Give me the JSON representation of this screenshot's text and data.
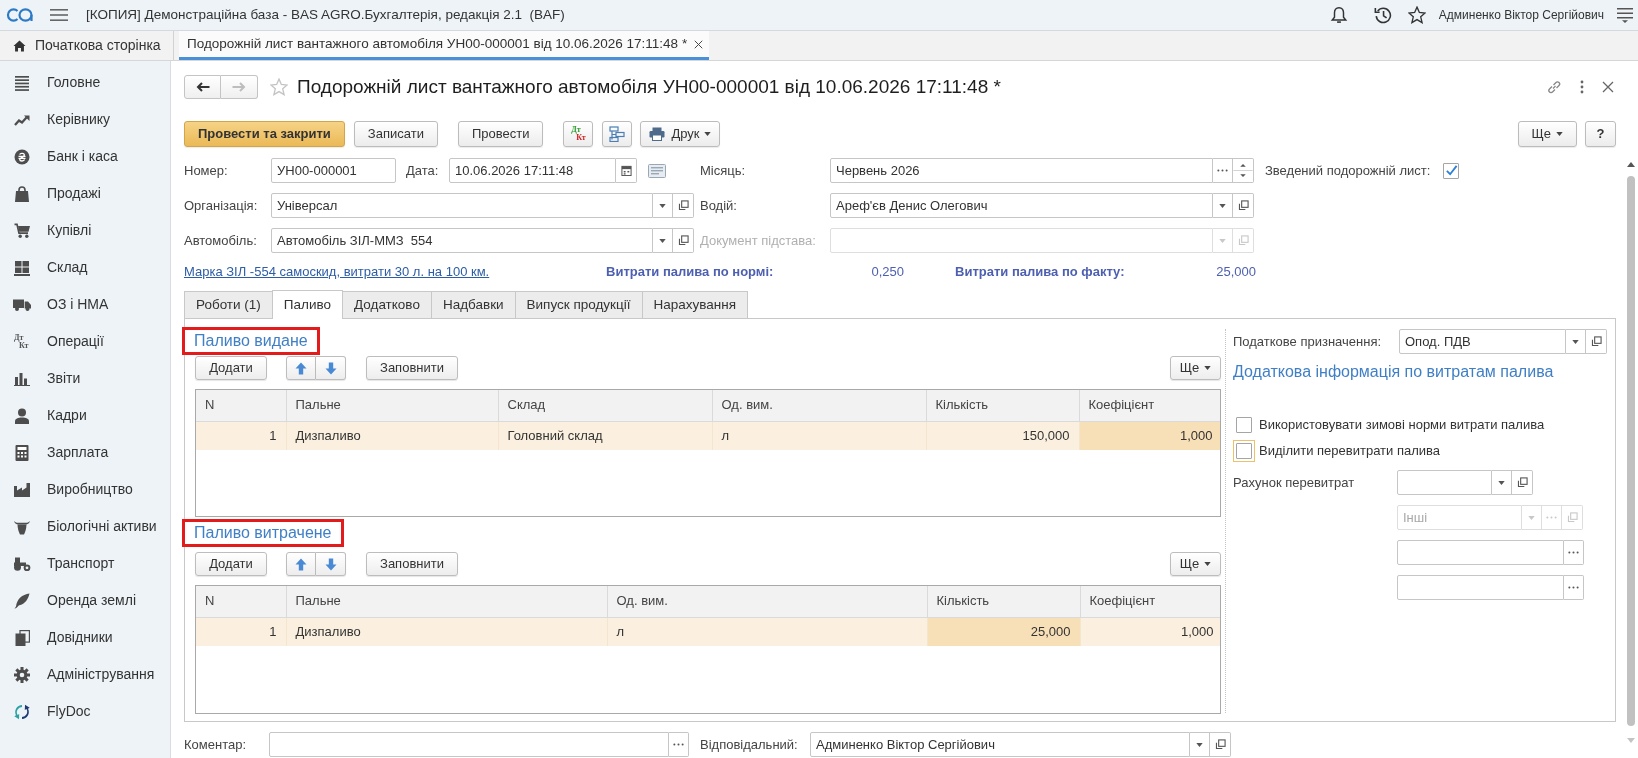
{
  "window": {
    "title": "[КОПИЯ] Демонстраційна база - BAS AGRO.Бухгалтерія, редакція 2.1  (BAF)",
    "user": "Админенко Віктор Сергійович"
  },
  "tab_strip": {
    "home": "Початкова сторінка",
    "tabs": [
      {
        "label": "Подорожній лист вантажного автомобіля УН00-000001 від 10.06.2026 17:11:48 *",
        "selected": true
      }
    ]
  },
  "sidebar": {
    "items": [
      {
        "label": "Головне"
      },
      {
        "label": "Керівнику"
      },
      {
        "label": "Банк і каса"
      },
      {
        "label": "Продажі"
      },
      {
        "label": "Купівлі"
      },
      {
        "label": "Склад"
      },
      {
        "label": "ОЗ і НМА"
      },
      {
        "label": "Операції",
        "icon_lines": [
          "Дт",
          "Кт"
        ]
      },
      {
        "label": "Звіти"
      },
      {
        "label": "Кадри"
      },
      {
        "label": "Зарплата"
      },
      {
        "label": "Виробництво"
      },
      {
        "label": "Біологічні активи"
      },
      {
        "label": "Транспорт"
      },
      {
        "label": "Оренда землі"
      },
      {
        "label": "Довідники"
      },
      {
        "label": "Адміністрування"
      },
      {
        "label": "FlyDoc"
      }
    ]
  },
  "document": {
    "title": "Подорожній лист вантажного автомобіля УН00-000001 від 10.06.2026 17:11:48 *"
  },
  "toolbar": {
    "buttons": [
      {
        "kind": "primary",
        "label": "Провести та закрити"
      },
      {
        "kind": "default",
        "label": "Записати"
      },
      {
        "kind": "default",
        "label": "Провести"
      },
      {
        "kind": "accounting",
        "lines": [
          "Дт",
          "Кт"
        ]
      },
      {
        "kind": "structure"
      },
      {
        "kind": "print",
        "label": "Друк"
      }
    ],
    "more": "Ще",
    "help": "?"
  },
  "form": {
    "number": {
      "label": "Номер:",
      "value": "УН00-000001"
    },
    "date": {
      "label": "Дата:",
      "value": "10.06.2026 17:11:48"
    },
    "month": {
      "label": "Місяць:",
      "value": "Червень 2026"
    },
    "summary_sheet": {
      "label": "Зведений подорожній лист:",
      "checked": true
    },
    "organization": {
      "label": "Організація:",
      "value": "Універсал"
    },
    "driver": {
      "label": "Водій:",
      "value": "Ареф'єв Денис Олегович"
    },
    "vehicle": {
      "label": "Автомобіль:",
      "value": "Автомобіль ЗІЛ-ММЗ  554"
    },
    "base_document": {
      "label": "Документ підстава:",
      "disabled": true
    }
  },
  "fuel_summary": {
    "link": "Марка ЗІЛ -554 самоскид, витрати 30 л. на 100 км.",
    "norm_label": "Витрати палива по нормі:",
    "norm_value": "0,250",
    "fact_label": "Витрати палива по факту:",
    "fact_value": "25,000"
  },
  "tabs": [
    {
      "label": "Роботи (1)",
      "selected": false
    },
    {
      "label": "Паливо",
      "selected": true
    },
    {
      "label": "Додатково",
      "selected": false
    },
    {
      "label": "Надбавки",
      "selected": false
    },
    {
      "label": "Випуск продукції",
      "selected": false
    },
    {
      "label": "Нарахування",
      "selected": false
    }
  ],
  "fuel_issued": {
    "title": "Паливо видане",
    "highlighted": true,
    "add": "Додати",
    "fill": "Заповнити",
    "more": "Ще",
    "columns": [
      {
        "label": "N",
        "kind": "number"
      },
      {
        "label": "Пальне",
        "kind": "text"
      },
      {
        "label": "Склад",
        "kind": "text"
      },
      {
        "label": "Од. вим.",
        "kind": "text"
      },
      {
        "label": "Кількість",
        "kind": "number"
      },
      {
        "label": "Коефіцієнт",
        "kind": "number"
      }
    ],
    "rows": [
      {
        "selected": true,
        "cells": [
          {
            "text": "1",
            "current": false
          },
          {
            "text": "Дизпаливо",
            "current": false
          },
          {
            "text": "Головний склад",
            "current": false
          },
          {
            "text": "л",
            "current": false
          },
          {
            "text": "150,000",
            "current": false
          },
          {
            "text": "1,000",
            "current": true
          }
        ]
      }
    ]
  },
  "fuel_used": {
    "title": "Паливо витрачене",
    "highlighted": true,
    "add": "Додати",
    "fill": "Заповнити",
    "more": "Ще",
    "columns": [
      {
        "label": "N",
        "kind": "number"
      },
      {
        "label": "Пальне",
        "kind": "text"
      },
      {
        "label": "Од. вим.",
        "kind": "text"
      },
      {
        "label": "Кількість",
        "kind": "number"
      },
      {
        "label": "Коефіцієнт",
        "kind": "number"
      }
    ],
    "rows": [
      {
        "selected": true,
        "cells": [
          {
            "text": "1",
            "current": false
          },
          {
            "text": "Дизпаливо",
            "current": false
          },
          {
            "text": "л",
            "current": false
          },
          {
            "text": "25,000",
            "current": true
          },
          {
            "text": "1,000",
            "current": false
          }
        ]
      }
    ]
  },
  "extra": {
    "tax_purpose": {
      "label": "Податкове призначення:",
      "value": "Опод. ПДВ"
    },
    "title": "Додаткова інформація по витратам палива",
    "options": [
      {
        "label": "Використовувати зимові норми витрати палива",
        "checked": false,
        "focused": false
      },
      {
        "label": "Виділити перевитрати палива",
        "checked": false,
        "focused": true
      }
    ],
    "overspend_account": {
      "label": "Рахунок перевитрат",
      "fields": [
        {
          "kind": "select",
          "disabled": false
        },
        {
          "kind": "select_choose",
          "value": "Інші",
          "disabled": true
        },
        {
          "kind": "choose",
          "disabled": false
        },
        {
          "kind": "choose",
          "disabled": false
        }
      ]
    }
  },
  "footer": {
    "comment": {
      "label": "Коментар:"
    },
    "responsible": {
      "label": "Відповідальний:",
      "value": "Админенко Віктор Сергійович"
    }
  }
}
